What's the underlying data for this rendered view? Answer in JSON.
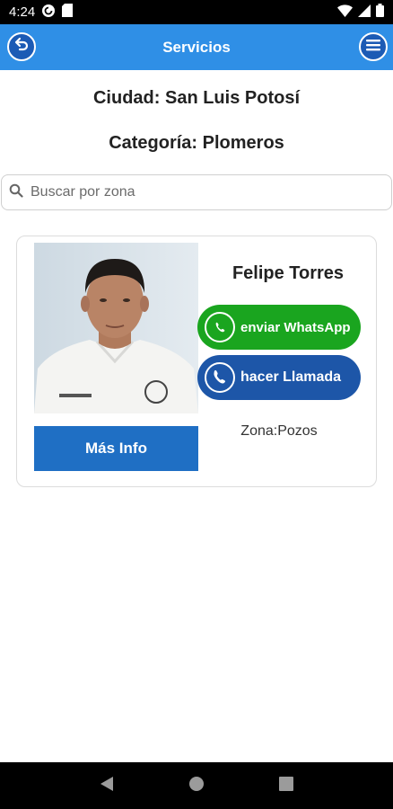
{
  "status_bar": {
    "time": "4:24",
    "left_icons": [
      "pocket-casts-icon",
      "sd-card-icon"
    ],
    "right_icons": [
      "wifi-icon",
      "signal-icon",
      "battery-icon"
    ]
  },
  "header": {
    "title": "Servicios",
    "back_icon": "undo-arrow-icon",
    "menu_icon": "hamburger-menu-icon",
    "background": "#2f8fe6"
  },
  "city_label": "Ciudad: San Luis Potosí",
  "category_label": "Categoría: Plomeros",
  "search": {
    "placeholder": "Buscar por zona",
    "value": "",
    "icon": "search-icon"
  },
  "provider_card": {
    "name": "Felipe Torres",
    "photo": "person-photo",
    "whatsapp_label": "enviar WhatsApp",
    "call_label": "hacer Llamada",
    "zone": "Zona:Pozos",
    "more_info_label": "Más Info",
    "colors": {
      "whatsapp": "#1aa51f",
      "call": "#1d56a8",
      "more_info": "#1f6fc4"
    }
  },
  "nav_bar": {
    "buttons": [
      "back-triangle-icon",
      "home-circle-icon",
      "recents-square-icon"
    ]
  }
}
